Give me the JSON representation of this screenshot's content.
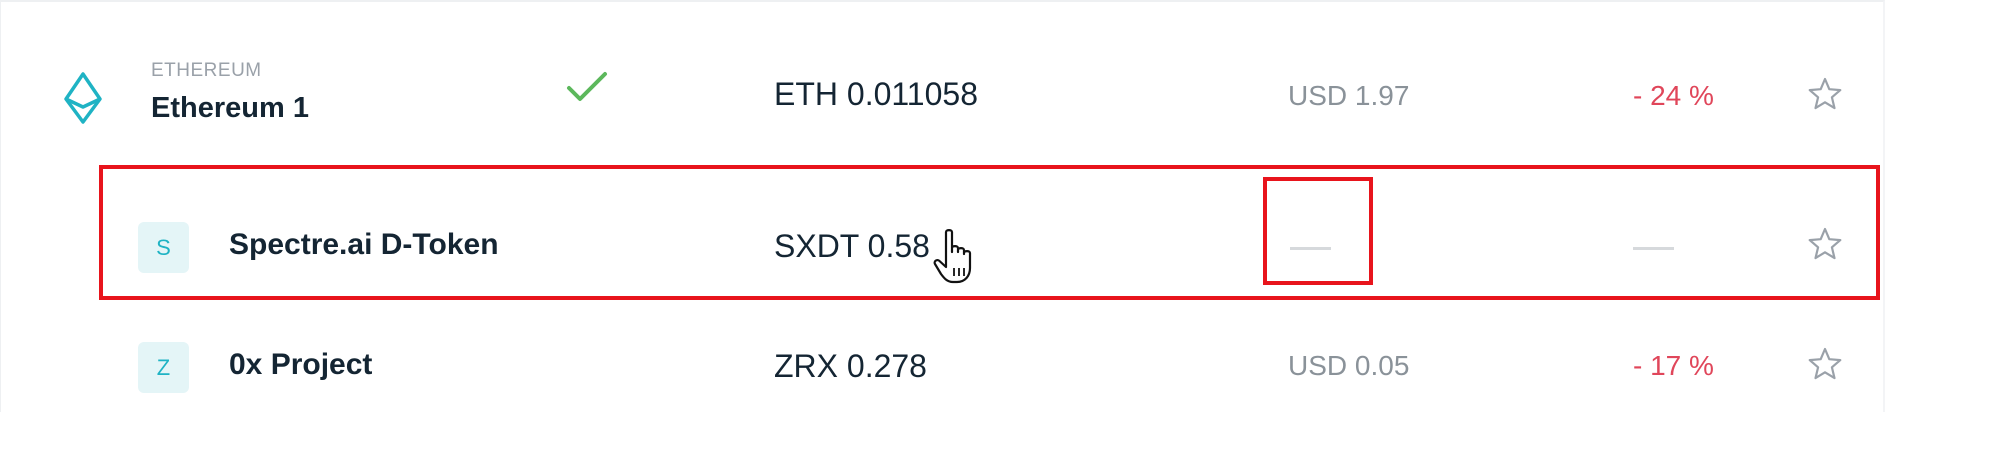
{
  "accounts": [
    {
      "type_label": "ETHEREUM",
      "name": "Ethereum 1",
      "balance": "ETH 0.011058",
      "fiat": "USD 1.97",
      "change": "- 24 %",
      "icon": "ethereum-icon",
      "status_icon": "checkmark-icon",
      "starred": false
    }
  ],
  "tokens": [
    {
      "badge": "S",
      "name": "Spectre.ai D-Token",
      "balance": "SXDT 0.58",
      "fiat": "—",
      "change": "—",
      "starred": false
    },
    {
      "badge": "Z",
      "name": "0x Project",
      "balance": "ZRX 0.278",
      "fiat": "USD 0.05",
      "change": "- 17 %",
      "starred": false
    }
  ],
  "colors": {
    "accent": "#1fb3c4",
    "negative": "#e0465a",
    "positive": "#5cb85c",
    "highlight": "#e8141c",
    "text": "#142533",
    "muted": "#8a9299"
  }
}
